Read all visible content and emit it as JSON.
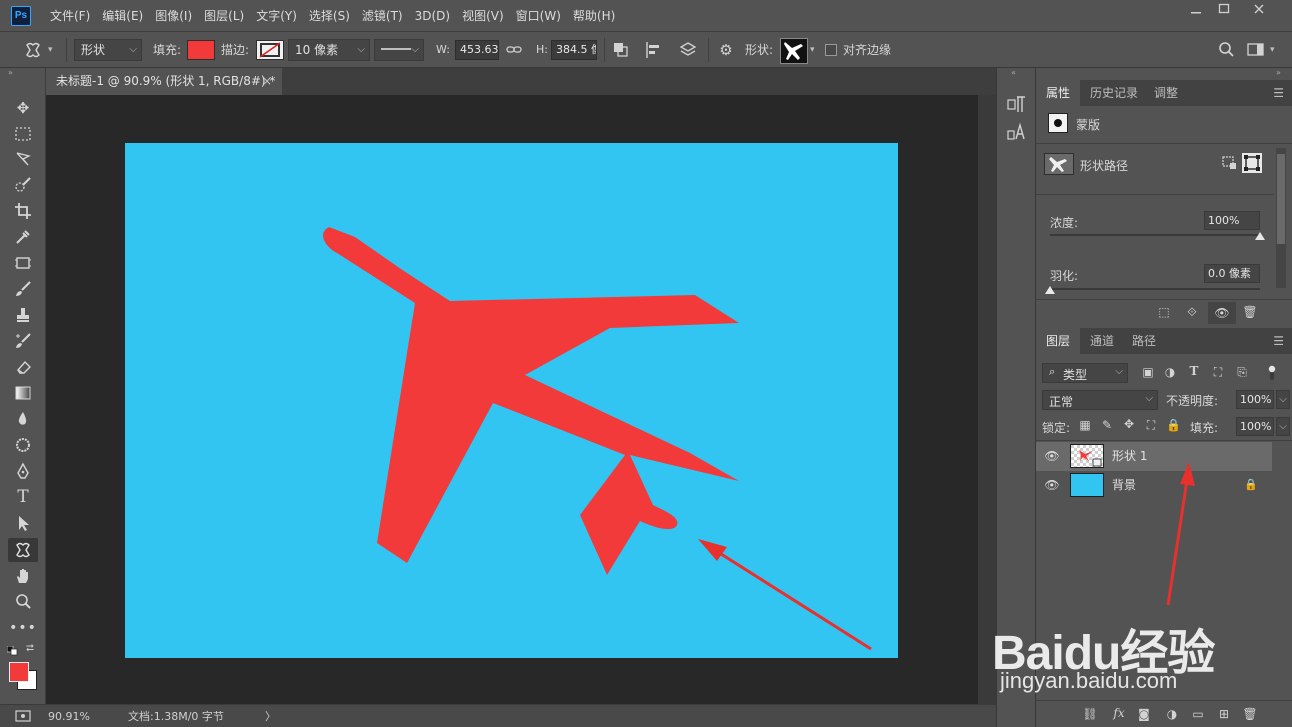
{
  "app": {
    "logo": "Ps",
    "menu": [
      "文件(F)",
      "编辑(E)",
      "图像(I)",
      "图层(L)",
      "文字(Y)",
      "选择(S)",
      "滤镜(T)",
      "3D(D)",
      "视图(V)",
      "窗口(W)",
      "帮助(H)"
    ]
  },
  "options": {
    "mode": "形状",
    "fill_label": "填充:",
    "fill_color": "#f23a3a",
    "stroke_label": "描边:",
    "stroke_width": "10 像素",
    "w_label": "W:",
    "w_value": "453.63 像",
    "h_label": "H:",
    "h_value": "384.5 像",
    "shape_label": "形状:",
    "align_edges": "对齐边缘"
  },
  "document": {
    "tab_title": "未标题-1 @ 90.9% (形状 1, RGB/8#) *",
    "close_glyph": "×",
    "canvas_color": "#33c5f2",
    "shape_color": "#f23a3a",
    "arrow_color": "#e8302c"
  },
  "status": {
    "zoom": "90.91%",
    "doc_info": "文档:1.38M/0 字节",
    "more": "〉"
  },
  "properties": {
    "tabs": [
      "属性",
      "历史记录",
      "调整"
    ],
    "active_tab": 0,
    "mask_label": "蒙版",
    "shape_path_label": "形状路径",
    "density_label": "浓度:",
    "density_value": "100%",
    "density_level": 1.0,
    "feather_label": "羽化:",
    "feather_value": "0.0 像素",
    "feather_level": 0.0
  },
  "layers": {
    "tabs": [
      "图层",
      "通道",
      "路径"
    ],
    "active_tab": 0,
    "filter_kind": "类型",
    "blend_mode": "正常",
    "opacity_label": "不透明度:",
    "opacity_value": "100%",
    "lock_label": "锁定:",
    "fill_label": "填充:",
    "fill_value": "100%",
    "items": [
      {
        "name": "形状 1",
        "selected": true,
        "locked": false
      },
      {
        "name": "背景",
        "selected": false,
        "locked": true
      }
    ],
    "bottom_icons": [
      "link-icon",
      "fx",
      "mask-icon",
      "adjustment-icon",
      "folder-icon",
      "new-layer-icon",
      "trash-icon"
    ]
  },
  "watermark": {
    "brand": "Baidu经验",
    "url": "jingyan.baidu.com"
  }
}
